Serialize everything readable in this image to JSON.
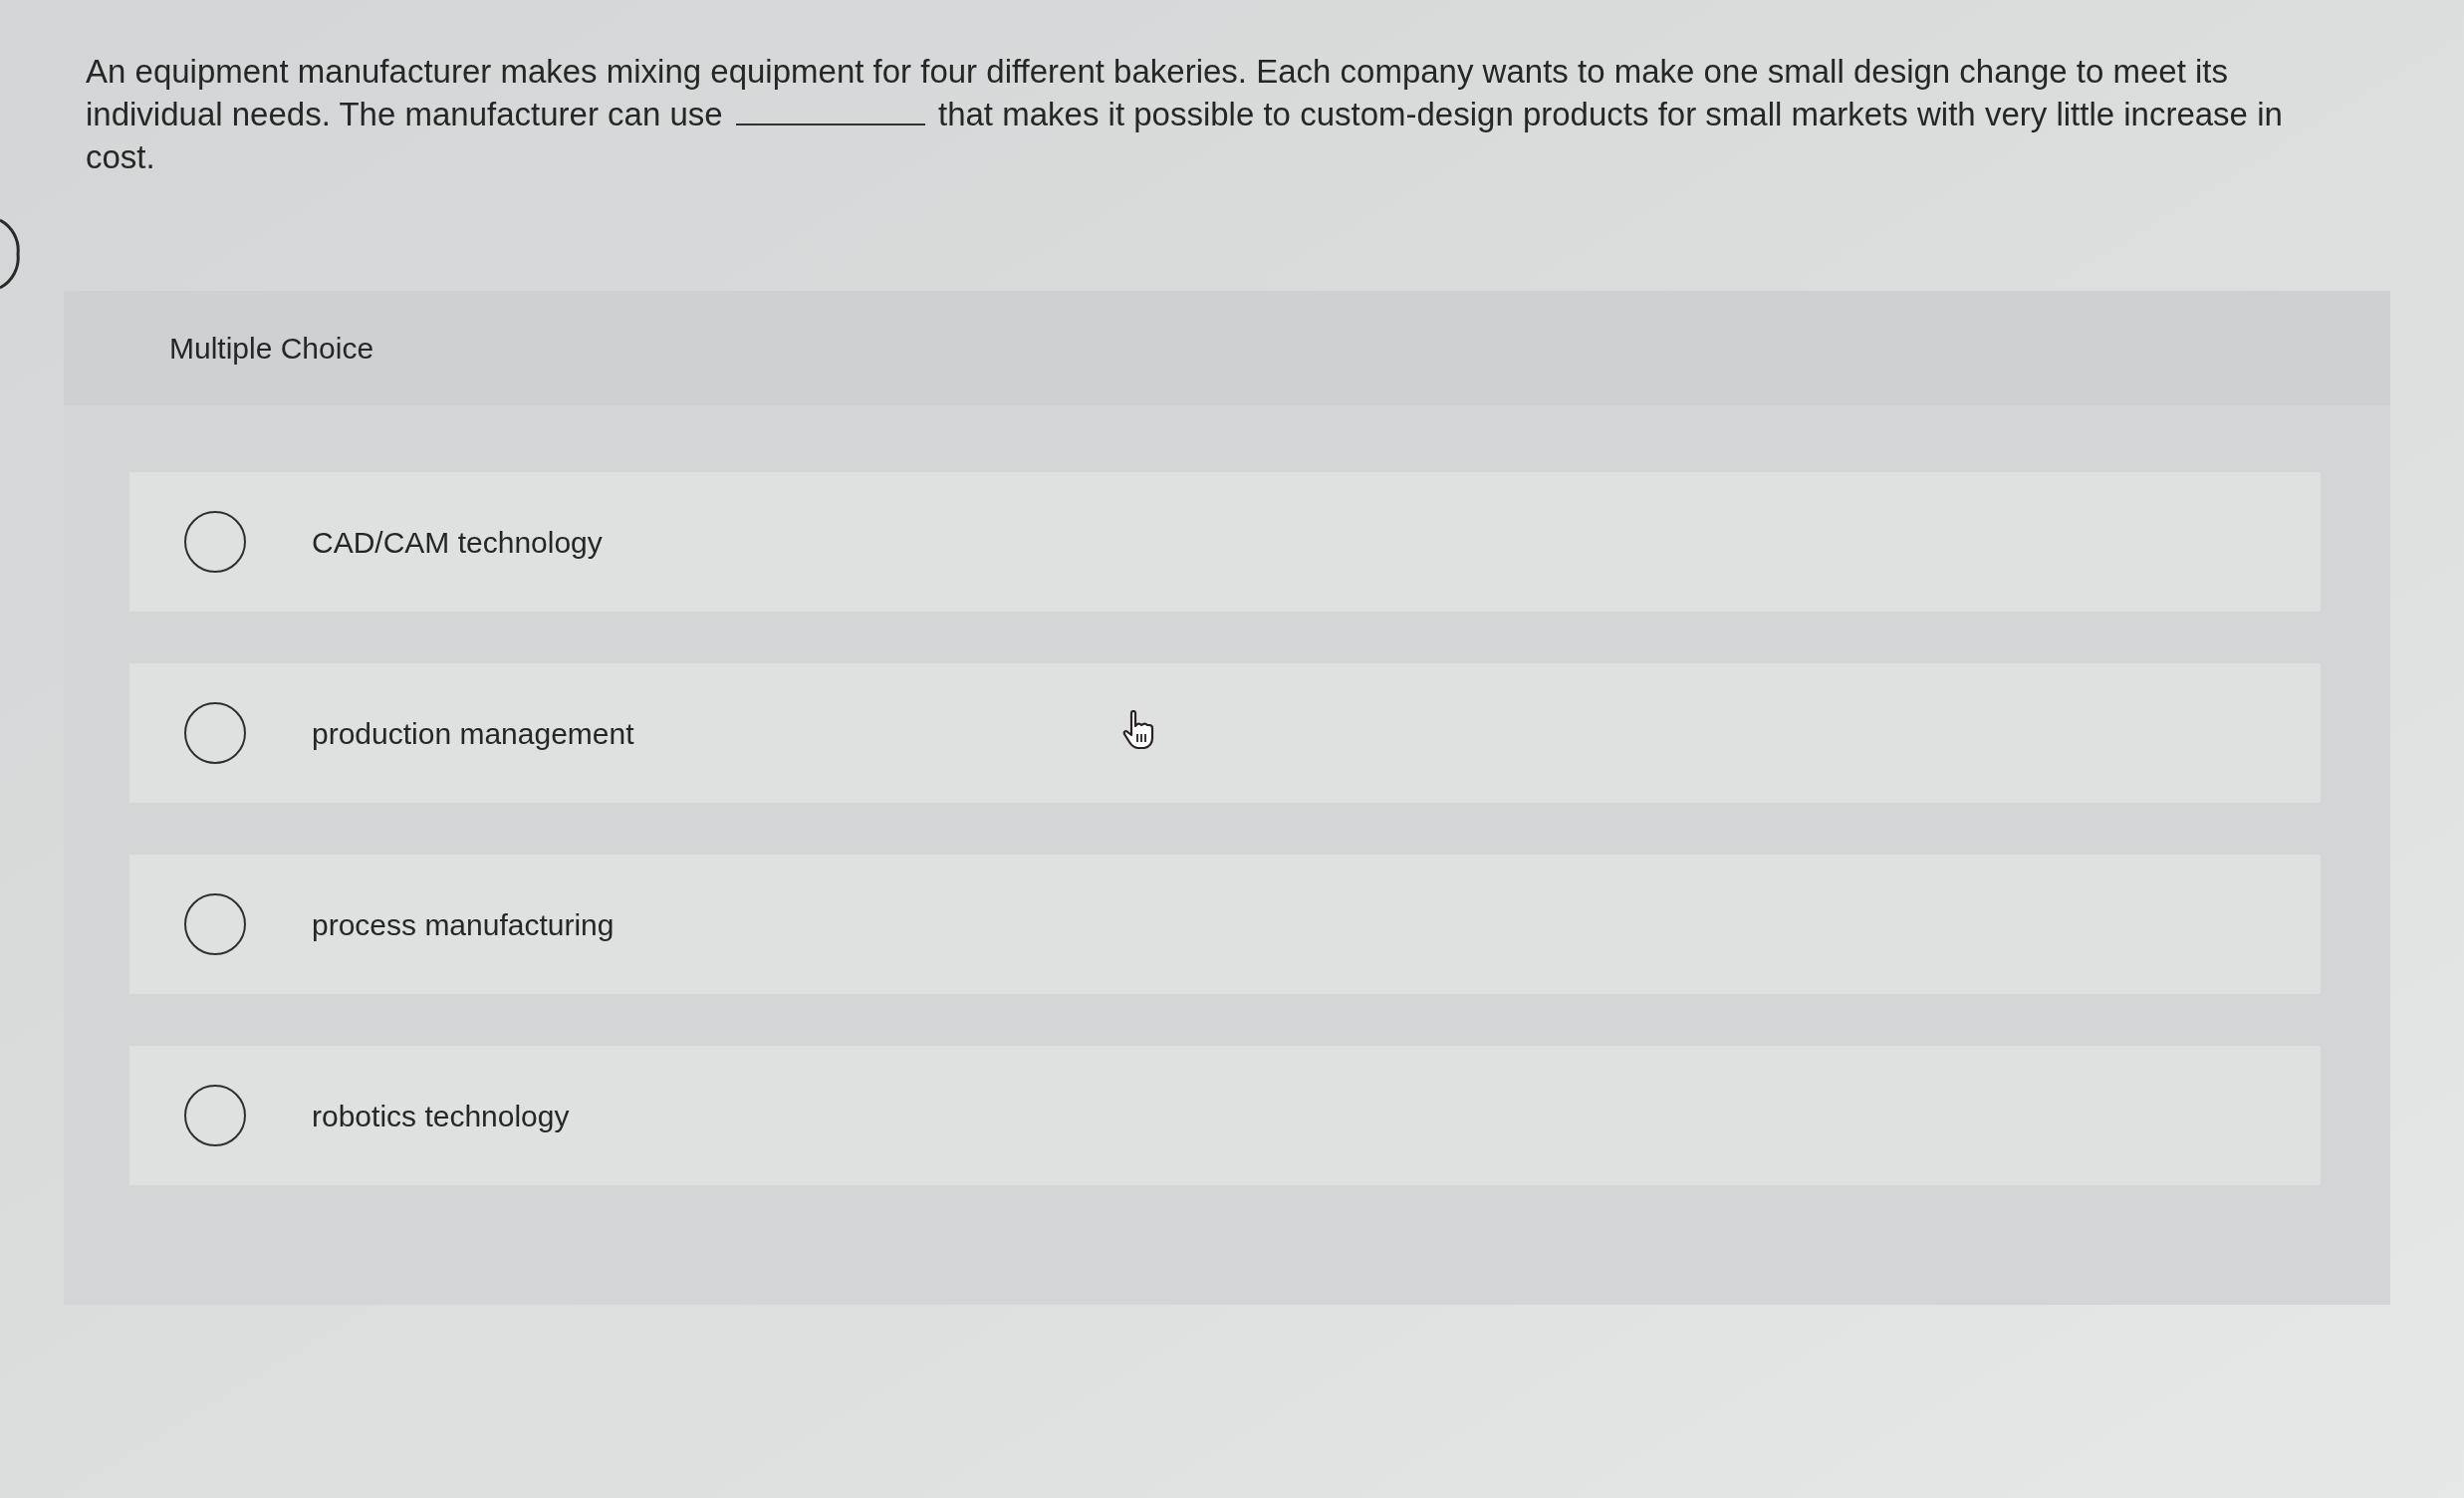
{
  "question": {
    "text_before": "An equipment manufacturer makes mixing equipment for four different bakeries. Each company wants to make one small design change to meet its individual needs. The manufacturer can use",
    "text_after": "that makes it possible to custom-design products for small markets with very little increase in cost."
  },
  "panel": {
    "title": "Multiple Choice"
  },
  "options": [
    {
      "label": "CAD/CAM technology",
      "selected": false
    },
    {
      "label": "production management",
      "selected": false
    },
    {
      "label": "process manufacturing",
      "selected": false
    },
    {
      "label": "robotics technology",
      "selected": false
    }
  ]
}
